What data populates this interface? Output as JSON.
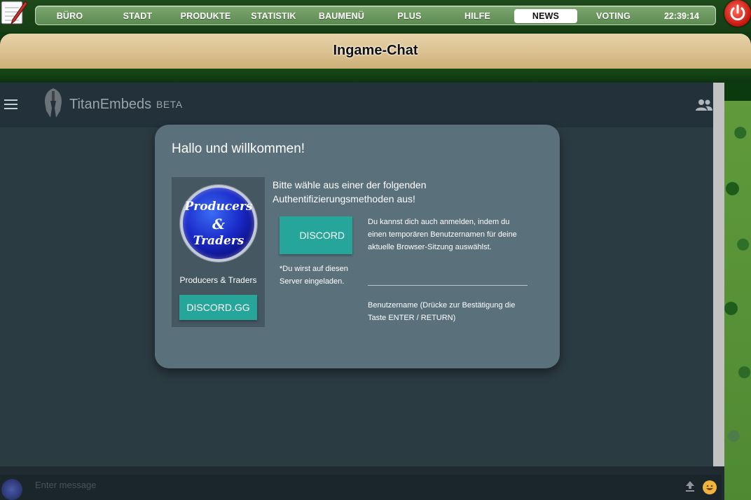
{
  "nav": {
    "items": [
      "BÜRO",
      "STADT",
      "PRODUKTE",
      "STATISTIK",
      "BAUMENÜ",
      "PLUS",
      "HILFE",
      "NEWS",
      "VOTING"
    ],
    "active": "NEWS",
    "clock": "22:39:14"
  },
  "chat": {
    "title": "Ingame-Chat"
  },
  "embed": {
    "brand": "TitanEmbeds",
    "brand_suffix": "BETA",
    "modal": {
      "title": "Hallo und willkommen!",
      "server_logo_lines": [
        "Producers",
        "&",
        "Traders"
      ],
      "server_name": "Producers & Traders",
      "discordgg_label": "DISCORD.GG",
      "auth_prompt": "Bitte wähle aus einer der folgenden Authentifizierungsmethoden aus!",
      "discord_label": "DISCORD",
      "invite_note": "*Du wirst auf diesen Server eingeladen.",
      "temp_note": "Du kannst dich auch anmelden, indem du einen temporären Benutzernamen für deine aktuelle Browser-Sitzung auswählst.",
      "username_label": "Benutzername (Drücke zur Bestätigung die Taste ENTER / RETURN)"
    },
    "message": {
      "placeholder": "Enter message"
    }
  },
  "colors": {
    "accent": "#26a69a",
    "modal_bg": "#5a707b",
    "embed_bg": "#2b3b42",
    "nav_active_bg": "#ffffff"
  }
}
